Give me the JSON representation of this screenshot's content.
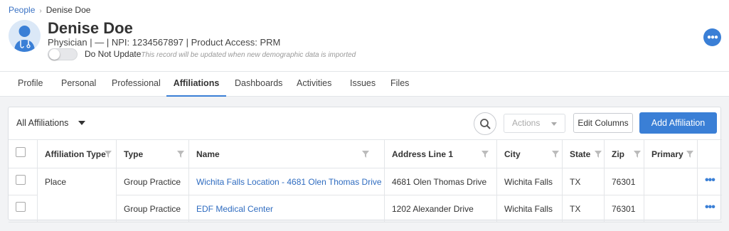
{
  "breadcrumb": {
    "parent": "People",
    "current": "Denise Doe"
  },
  "profile": {
    "name": "Denise Doe",
    "subline": "Physician | — | NPI: 1234567897 | Product Access: PRM",
    "toggle_label": "Do Not Update",
    "toggle_note": "This record will be updated when new demographic data is imported",
    "toggle_on": false
  },
  "tabs": [
    "Profile",
    "Personal",
    "Professional",
    "Affiliations",
    "Dashboards",
    "Activities",
    "Issues",
    "Files"
  ],
  "active_tab": "Affiliations",
  "toolbar": {
    "filter_label": "All Affiliations",
    "actions_label": "Actions",
    "edit_columns_label": "Edit Columns",
    "add_label": "Add Affiliation"
  },
  "table": {
    "columns": [
      "Affiliation Type",
      "Type",
      "Name",
      "Address Line 1",
      "City",
      "State",
      "Zip",
      "Primary"
    ],
    "group_label": "Place",
    "rows": [
      {
        "type": "Group Practice",
        "name": "Wichita Falls Location - 4681 Olen Thomas Drive",
        "address": "4681 Olen Thomas Drive",
        "city": "Wichita Falls",
        "state": "TX",
        "zip": "76301",
        "primary": ""
      },
      {
        "type": "Group Practice",
        "name": "EDF Medical Center",
        "address": "1202 Alexander Drive",
        "city": "Wichita Falls",
        "state": "TX",
        "zip": "76301",
        "primary": ""
      }
    ]
  },
  "colors": {
    "accent": "#3a7fd6",
    "link": "#2f6cc0",
    "background": "#f2f3f5"
  },
  "icons": {
    "more": "more-horizontal-icon",
    "search": "search-icon",
    "filter": "funnel-icon",
    "caret": "caret-down-icon",
    "avatar": "doctor-avatar-icon"
  }
}
